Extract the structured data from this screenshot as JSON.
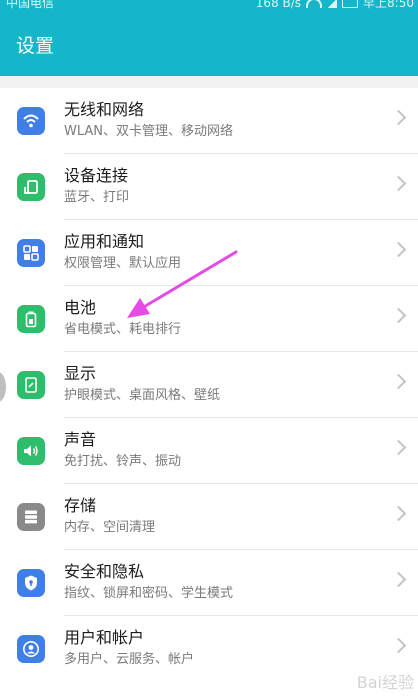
{
  "status_bar": {
    "carrier": "中国电信",
    "net_speed": "168 B/s",
    "time": "早上8:50"
  },
  "header": {
    "title": "设置"
  },
  "items": [
    {
      "title": "无线和网络",
      "subtitle": "WLAN、双卡管理、移动网络",
      "icon": "wifi-icon",
      "color": "#3f7fe6"
    },
    {
      "title": "设备连接",
      "subtitle": "蓝牙、打印",
      "icon": "device-connection-icon",
      "color": "#2ebd6a"
    },
    {
      "title": "应用和通知",
      "subtitle": "权限管理、默认应用",
      "icon": "apps-icon",
      "color": "#3f7fe6"
    },
    {
      "title": "电池",
      "subtitle": "省电模式、耗电排行",
      "icon": "battery-icon",
      "color": "#2ebd6a"
    },
    {
      "title": "显示",
      "subtitle": "护眼模式、桌面风格、壁纸",
      "icon": "display-icon",
      "color": "#2ebd6a"
    },
    {
      "title": "声音",
      "subtitle": "免打扰、铃声、振动",
      "icon": "sound-icon",
      "color": "#2ebd6a"
    },
    {
      "title": "存储",
      "subtitle": "内存、空间清理",
      "icon": "storage-icon",
      "color": "#8a8a8a"
    },
    {
      "title": "安全和隐私",
      "subtitle": "指纹、锁屏和密码、学生模式",
      "icon": "shield-icon",
      "color": "#3f7fe6"
    },
    {
      "title": "用户和帐户",
      "subtitle": "多用户、云服务、帐户",
      "icon": "user-icon",
      "color": "#3f7fe6"
    }
  ],
  "annotation": {
    "arrow_color": "#e64be6"
  },
  "watermark": {
    "text": "Bai经验"
  }
}
